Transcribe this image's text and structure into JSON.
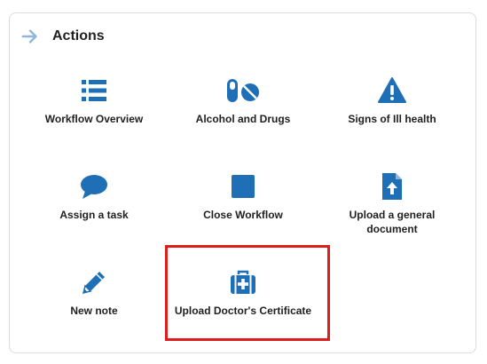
{
  "header": {
    "title": "Actions",
    "icon": "arrow-right-icon"
  },
  "actions": [
    {
      "label": "Workflow Overview",
      "icon": "list-icon"
    },
    {
      "label": "Alcohol and Drugs",
      "icon": "pills-icon"
    },
    {
      "label": "Signs of Ill health",
      "icon": "warning-icon"
    },
    {
      "label": "Assign a task",
      "icon": "speech-bubble-icon"
    },
    {
      "label": "Close Workflow",
      "icon": "stop-square-icon"
    },
    {
      "label": "Upload a general document",
      "icon": "file-upload-icon"
    },
    {
      "label": "New note",
      "icon": "pencil-icon"
    },
    {
      "label": "Upload Doctor's Certificate",
      "icon": "medical-kit-icon"
    }
  ],
  "colors": {
    "icon": "#1f6fb7",
    "arrow": "#8fb6da",
    "highlight": "#e01b1b"
  }
}
